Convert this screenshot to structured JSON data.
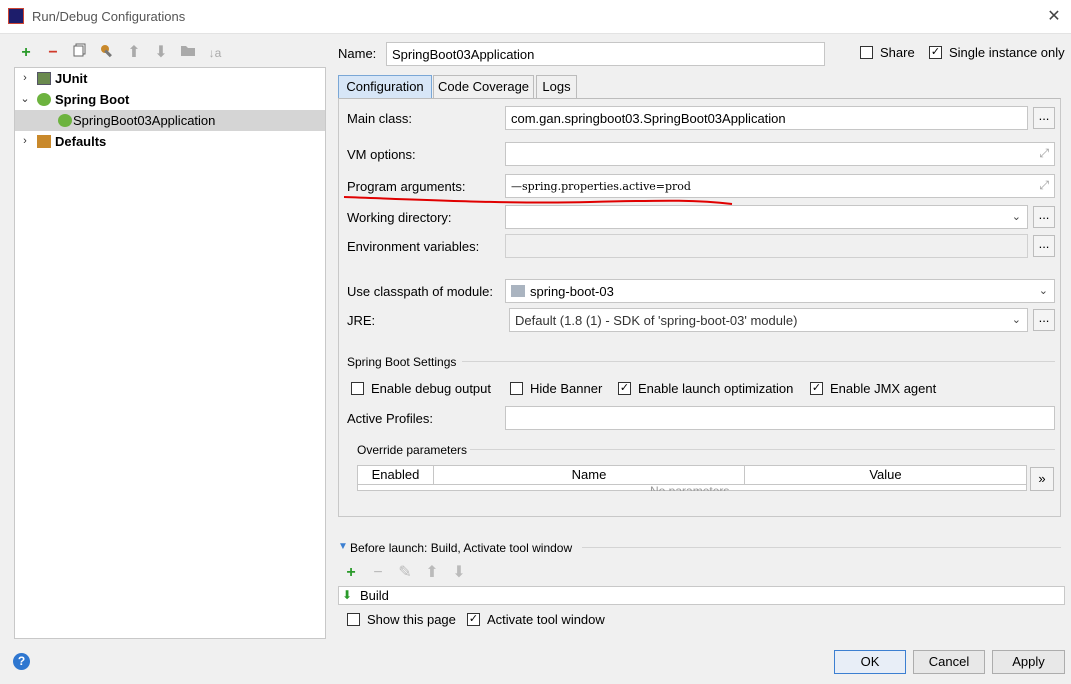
{
  "window": {
    "title": "Run/Debug Configurations"
  },
  "toolbar": {
    "icons": [
      "add-icon",
      "remove-icon",
      "copy-icon",
      "wrench-icon",
      "arrow-up-icon",
      "arrow-down-icon",
      "folder-icon",
      "sort-icon"
    ]
  },
  "tree": {
    "items": [
      {
        "label": "JUnit",
        "expanded": false,
        "bold": true
      },
      {
        "label": "Spring Boot",
        "expanded": true,
        "bold": true
      },
      {
        "label": "SpringBoot03Application",
        "selected": true
      },
      {
        "label": "Defaults",
        "expanded": false,
        "bold": true
      }
    ]
  },
  "header": {
    "name_label": "Name:",
    "name_value": "SpringBoot03Application",
    "share_label": "Share",
    "share_checked": false,
    "single_instance_label": "Single instance only",
    "single_instance_checked": true
  },
  "tabs": [
    {
      "label": "Configuration",
      "active": true
    },
    {
      "label": "Code Coverage",
      "active": false
    },
    {
      "label": "Logs",
      "active": false
    }
  ],
  "config": {
    "main_class_label": "Main class:",
    "main_class_value": "com.gan.springboot03.SpringBoot03Application",
    "vm_options_label": "VM options:",
    "vm_options_value": "",
    "program_args_label": "Program arguments:",
    "program_args_value": "—spring.properties.active=prod",
    "working_dir_label": "Working directory:",
    "working_dir_value": "",
    "env_vars_label": "Environment variables:",
    "env_vars_value": "",
    "classpath_label": "Use classpath of module:",
    "classpath_value": "spring-boot-03",
    "jre_label": "JRE:",
    "jre_value": "Default (1.8 (1) - SDK of 'spring-boot-03' module)",
    "dots": "..."
  },
  "spring_boot_settings": {
    "title": "Spring Boot Settings",
    "enable_debug_label": "Enable debug output",
    "enable_debug_checked": false,
    "hide_banner_label": "Hide Banner",
    "hide_banner_checked": false,
    "launch_opt_label": "Enable launch optimization",
    "launch_opt_checked": true,
    "jmx_label": "Enable JMX agent",
    "jmx_checked": true,
    "active_profiles_label": "Active Profiles:",
    "active_profiles_value": "",
    "override_title": "Override parameters",
    "columns": [
      "Enabled",
      "Name",
      "Value"
    ],
    "empty_text": "No parameters",
    "expand_label": "»"
  },
  "before_launch": {
    "title": "Before launch: Build, Activate tool window",
    "task": "Build",
    "show_page_label": "Show this page",
    "show_page_checked": false,
    "activate_label": "Activate tool window",
    "activate_checked": true
  },
  "buttons": {
    "ok": "OK",
    "cancel": "Cancel",
    "apply": "Apply"
  },
  "colors": {
    "accent": "#3c7fd1",
    "annotation": "#e00000",
    "selection": "#d5d5d5"
  }
}
